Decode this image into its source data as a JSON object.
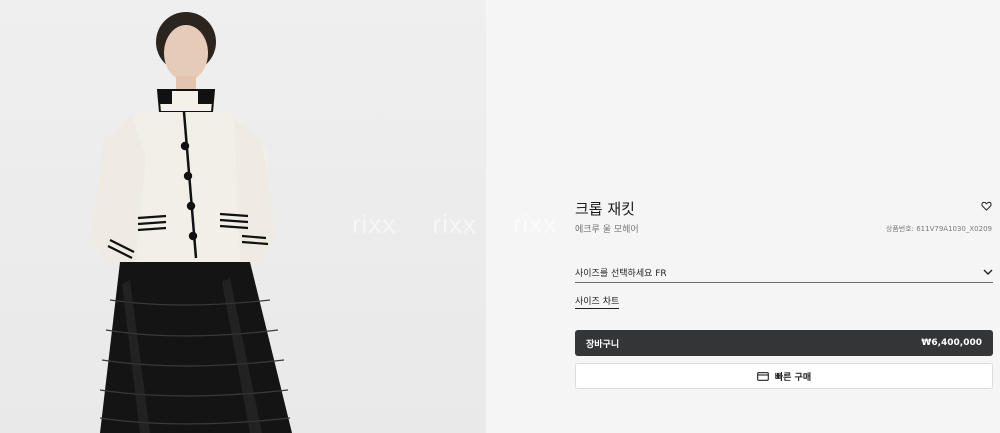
{
  "product": {
    "name": "크롭 재킷",
    "material": "에크루 울 모헤어",
    "sku_label": "상품번호: 611V79A1030_X0209",
    "image_alt": "model-wearing-ecru-cropped-jacket-with-black-tulle-skirt"
  },
  "watermark": {
    "text": [
      "rixx",
      "rixx",
      "rixx"
    ]
  },
  "options": {
    "size_prompt": "사이즈를 선택하세요 FR",
    "size_chart_label": "사이즈 차트"
  },
  "actions": {
    "cart_label": "장바구니",
    "price": "₩6,400,000",
    "quick_buy_label": "빠른 구매"
  },
  "icons": {
    "wishlist": "heart-outline-icon",
    "dropdown": "chevron-down-icon",
    "quick_buy": "card-icon"
  },
  "colors": {
    "cart_button_bg": "#333537",
    "page_bg": "#f5f5f5"
  }
}
